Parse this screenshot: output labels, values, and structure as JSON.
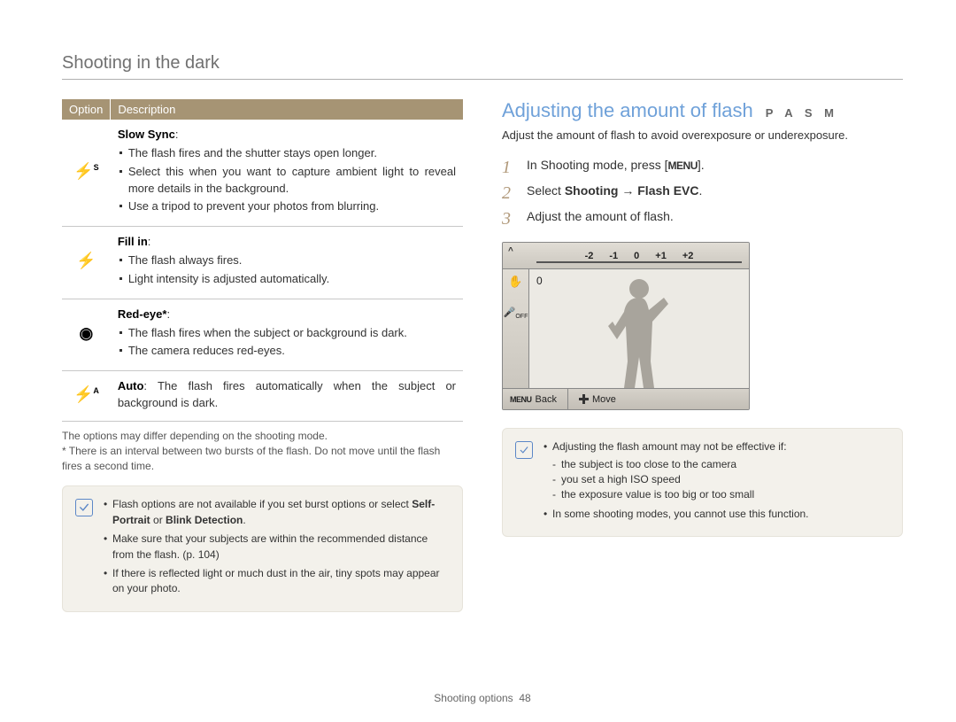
{
  "header": {
    "title": "Shooting in the dark"
  },
  "table": {
    "headers": {
      "option": "Option",
      "description": "Description"
    },
    "rows": [
      {
        "icon": "slow-sync",
        "name": "Slow Sync",
        "bullets": [
          "The flash fires and the shutter stays open longer.",
          "Select this when you want to capture ambient light to reveal more details in the background.",
          "Use a tripod to prevent your photos from blurring."
        ]
      },
      {
        "icon": "fill-in",
        "name": "Fill in",
        "bullets": [
          "The flash always fires.",
          "Light intensity is adjusted automatically."
        ]
      },
      {
        "icon": "red-eye",
        "name": "Red-eye*",
        "bullets": [
          "The flash fires when the subject or background is dark.",
          "The camera reduces red-eyes."
        ]
      },
      {
        "icon": "auto",
        "name": "Auto",
        "inline": "The flash fires automatically when the subject or background is dark."
      }
    ]
  },
  "table_notes": [
    "The options may differ depending on the shooting mode.",
    "* There is an interval between two bursts of the flash. Do not move until the flash fires a second time."
  ],
  "left_notebox": {
    "items": [
      {
        "prefix": "Flash options are not available if you set burst options or select ",
        "bold": "Self-Portrait",
        "mid": " or ",
        "bold2": "Blink Detection",
        "suffix": "."
      },
      {
        "text": "Make sure that your subjects are within the recommended distance from the flash. (p. 104)"
      },
      {
        "text": "If there is reflected light or much dust in the air, tiny spots may appear on your photo."
      }
    ]
  },
  "right": {
    "title": "Adjusting the amount of flash",
    "modes": "P A S M",
    "intro": "Adjust the amount of flash to avoid overexposure or underexposure.",
    "steps": {
      "s1_pre": "In Shooting mode, press [",
      "s1_key": "MENU",
      "s1_post": "].",
      "s2_pre": "Select ",
      "s2_b1": "Shooting",
      "s2_arrow": " → ",
      "s2_b2": "Flash EVC",
      "s2_post": ".",
      "s3": "Adjust the amount of flash."
    },
    "screen": {
      "ticks": [
        "-2",
        "-1",
        "0",
        "+1",
        "+2"
      ],
      "value": "0",
      "back": "Back",
      "move": "Move",
      "menu": "MENU"
    },
    "notebox": {
      "lead": "Adjusting the flash amount may not be effective if:",
      "dashes": [
        "the subject is too close to the camera",
        "you set a high ISO speed",
        "the exposure value is too big or too small"
      ],
      "extra": "In some shooting modes, you cannot use this function."
    }
  },
  "footer": {
    "section": "Shooting options",
    "page": "48"
  }
}
